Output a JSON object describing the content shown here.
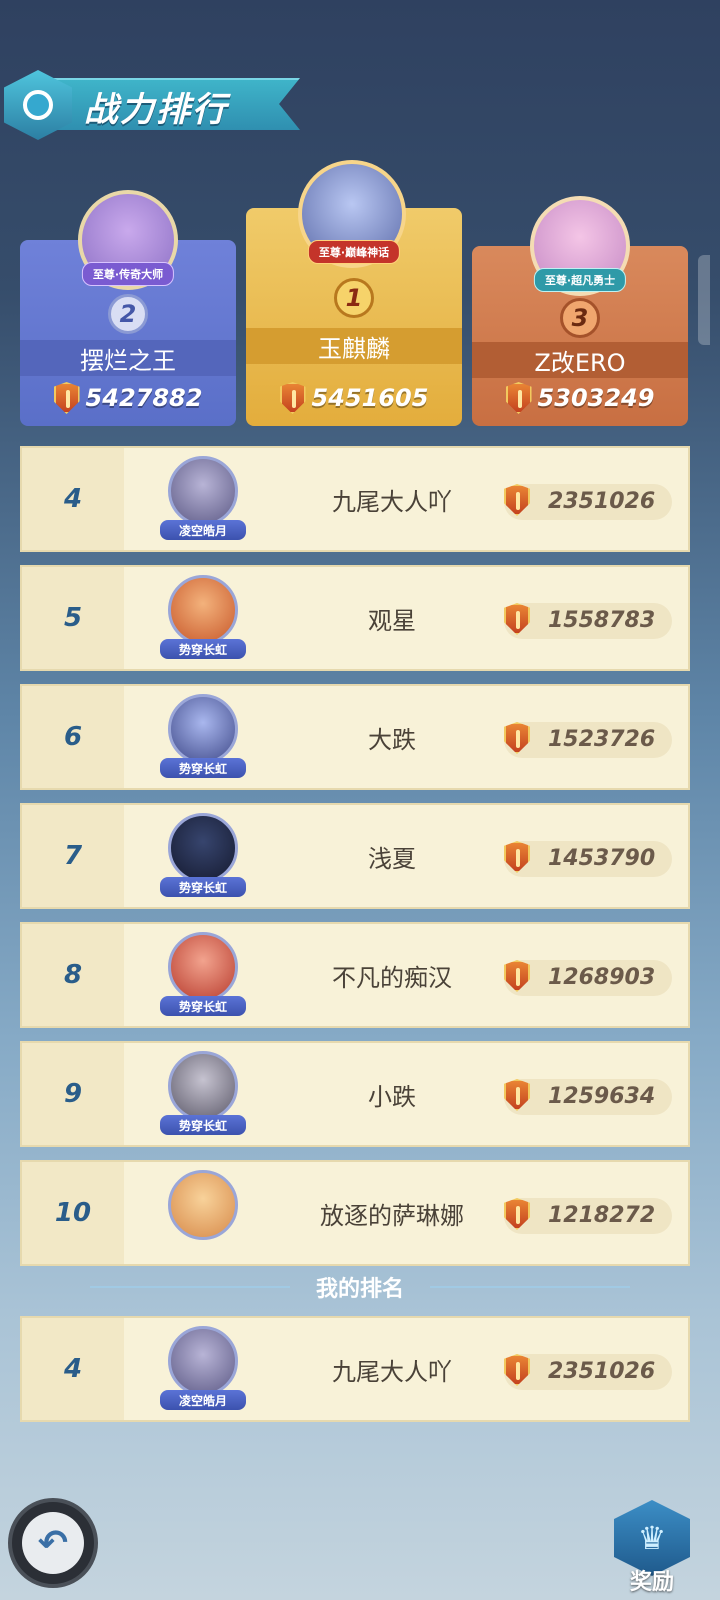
{
  "header": {
    "title": "战力排行"
  },
  "podium": [
    {
      "rank": "2",
      "name": "摆烂之王",
      "tier": "至尊·传奇大师",
      "power": "5427882",
      "color": "#5a6fc8"
    },
    {
      "rank": "1",
      "name": "玉麒麟",
      "tier": "至尊·巅峰神话",
      "power": "5451605",
      "color": "#e3ad3c"
    },
    {
      "rank": "3",
      "name": "Z改ERO",
      "tier": "至尊·超凡勇士",
      "power": "5303249",
      "color": "#c86f42"
    }
  ],
  "list": [
    {
      "rank": "4",
      "name": "九尾大人吖",
      "tag": "凌空皓月",
      "power": "2351026"
    },
    {
      "rank": "5",
      "name": "观星",
      "tag": "势穿长虹",
      "power": "1558783"
    },
    {
      "rank": "6",
      "name": "大跌",
      "tag": "势穿长虹",
      "power": "1523726"
    },
    {
      "rank": "7",
      "name": "浅夏",
      "tag": "势穿长虹",
      "power": "1453790"
    },
    {
      "rank": "8",
      "name": "不凡的痴汉",
      "tag": "势穿长虹",
      "power": "1268903"
    },
    {
      "rank": "9",
      "name": "小跌",
      "tag": "势穿长虹",
      "power": "1259634"
    },
    {
      "rank": "10",
      "name": "放逐的萨琳娜",
      "tag": "",
      "power": "1218272"
    }
  ],
  "my_rank": {
    "label": "我的排名",
    "rank": "4",
    "name": "九尾大人吖",
    "tag": "凌空皓月",
    "power": "2351026"
  },
  "footer": {
    "back_icon": "back-arrow-icon",
    "reward_label": "奖励",
    "reward_icon": "crown-icon"
  }
}
